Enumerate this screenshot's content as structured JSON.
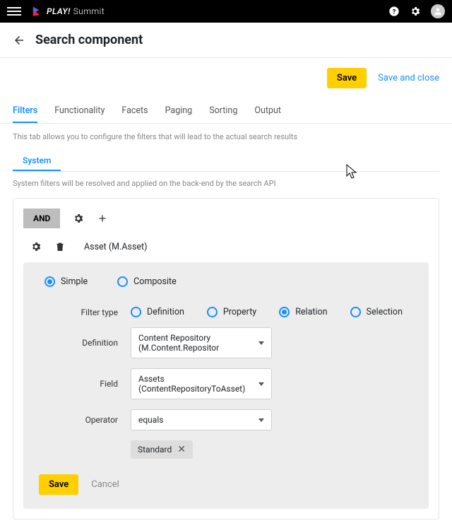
{
  "topbar": {
    "brand_bold": "PLAY!",
    "brand_thin": "Summit"
  },
  "header": {
    "title": "Search component"
  },
  "save_row": {
    "save": "Save",
    "save_close": "Save and close"
  },
  "tabs": {
    "items": [
      {
        "label": "Filters",
        "active": true
      },
      {
        "label": "Functionality"
      },
      {
        "label": "Facets"
      },
      {
        "label": "Paging"
      },
      {
        "label": "Sorting"
      },
      {
        "label": "Output"
      }
    ]
  },
  "desc": "This tab allows you to configure the filters that will lead to the actual search results",
  "subtab": "System",
  "hint": "System filters will be resolved and applied on the back-end by the search API",
  "toolbar": {
    "and": "AND"
  },
  "asset": "Asset (M.Asset)",
  "mode": {
    "simple": "Simple",
    "composite": "Composite"
  },
  "filter_type": {
    "label": "Filter type",
    "options": {
      "definition": "Definition",
      "property": "Property",
      "relation": "Relation",
      "selection": "Selection"
    },
    "selected": "relation"
  },
  "fields": {
    "definition": {
      "label": "Definition",
      "value": "Content Repository (M.Content.Repositor"
    },
    "field": {
      "label": "Field",
      "value": "Assets (ContentRepositoryToAsset)"
    },
    "operator": {
      "label": "Operator",
      "value": "equals"
    }
  },
  "chip": "Standard",
  "card_actions": {
    "save": "Save",
    "cancel": "Cancel"
  }
}
